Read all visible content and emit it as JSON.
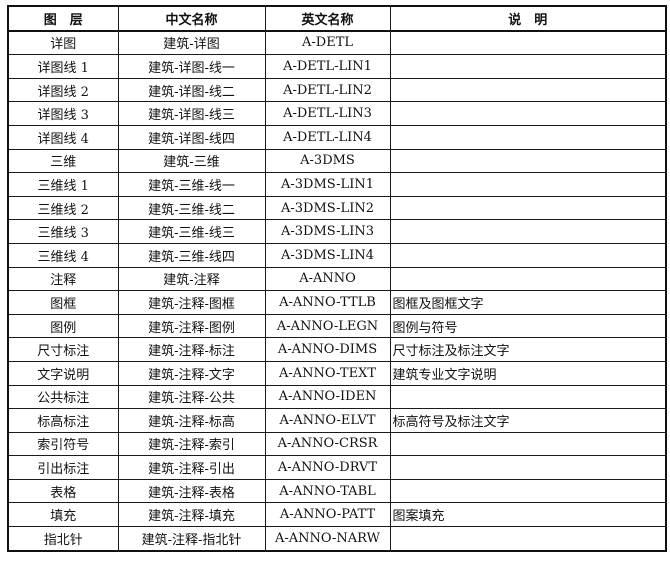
{
  "table": {
    "headers": [
      "图　层",
      "中文名称",
      "英文名称",
      "说　明"
    ],
    "rows": [
      [
        "详图",
        "建筑-详图",
        "A-DETL",
        ""
      ],
      [
        "详图线 1",
        "建筑-详图-线一",
        "A-DETL-LIN1",
        ""
      ],
      [
        "详图线 2",
        "建筑-详图-线二",
        "A-DETL-LIN2",
        ""
      ],
      [
        "详图线 3",
        "建筑-详图-线三",
        "A-DETL-LIN3",
        ""
      ],
      [
        "详图线 4",
        "建筑-详图-线四",
        "A-DETL-LIN4",
        ""
      ],
      [
        "三维",
        "建筑-三维",
        "A-3DMS",
        ""
      ],
      [
        "三维线 1",
        "建筑-三维-线一",
        "A-3DMS-LIN1",
        ""
      ],
      [
        "三维线 2",
        "建筑-三维-线二",
        "A-3DMS-LIN2",
        ""
      ],
      [
        "三维线 3",
        "建筑-三维-线三",
        "A-3DMS-LIN3",
        ""
      ],
      [
        "三维线 4",
        "建筑-三维-线四",
        "A-3DMS-LIN4",
        ""
      ],
      [
        "注释",
        "建筑-注释",
        "A-ANNO",
        ""
      ],
      [
        "图框",
        "建筑-注释-图框",
        "A-ANNO-TTLB",
        "图框及图框文字"
      ],
      [
        "图例",
        "建筑-注释-图例",
        "A-ANNO-LEGN",
        "图例与符号"
      ],
      [
        "尺寸标注",
        "建筑-注释-标注",
        "A-ANNO-DIMS",
        "尺寸标注及标注文字"
      ],
      [
        "文字说明",
        "建筑-注释-文字",
        "A-ANNO-TEXT",
        "建筑专业文字说明"
      ],
      [
        "公共标注",
        "建筑-注释-公共",
        "A-ANNO-IDEN",
        ""
      ],
      [
        "标高标注",
        "建筑-注释-标高",
        "A-ANNO-ELVT",
        "标高符号及标注文字"
      ],
      [
        "索引符号",
        "建筑-注释-索引",
        "A-ANNO-CRSR",
        ""
      ],
      [
        "引出标注",
        "建筑-注释-引出",
        "A-ANNO-DRVT",
        ""
      ],
      [
        "表格",
        "建筑-注释-表格",
        "A-ANNO-TABL",
        ""
      ],
      [
        "填充",
        "建筑-注释-填充",
        "A-ANNO-PATT",
        "图案填充"
      ],
      [
        "指北针",
        "建筑-注释-指北针",
        "A-ANNO-NARW",
        ""
      ]
    ]
  }
}
